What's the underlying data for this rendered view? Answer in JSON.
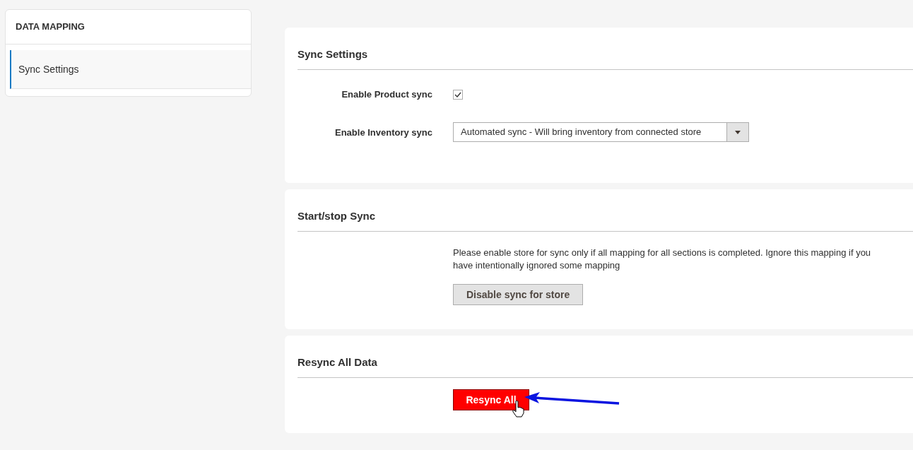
{
  "sidebar": {
    "title": "DATA MAPPING",
    "items": [
      {
        "label": "Sync Settings",
        "selected": true
      }
    ]
  },
  "sections": [
    {
      "kind": "settings",
      "title": "Sync Settings",
      "fields": [
        {
          "kind": "checkbox",
          "label": "Enable Product sync",
          "checked": true
        },
        {
          "kind": "select",
          "label": "Enable Inventory sync",
          "value": "Automated sync - Will bring inventory from connected store"
        }
      ]
    },
    {
      "kind": "sync",
      "title": "Start/stop Sync",
      "note": "Please enable store for sync only if all mapping for all sections is completed. Ignore this mapping if you have intentionally ignored some mapping",
      "button": "Disable sync for store"
    },
    {
      "kind": "resync",
      "title": "Resync All Data",
      "button": "Resync All"
    }
  ]
}
